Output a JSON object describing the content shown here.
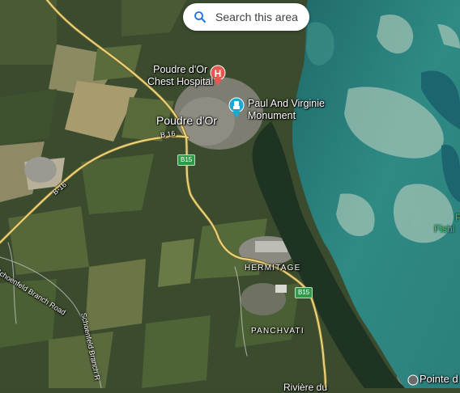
{
  "search": {
    "label": "Search this area",
    "icon": "search-icon"
  },
  "labels": {
    "chest_hospital": "Poudre d'Or\nChest Hospital",
    "monument": "Paul And Virginie\nMonument",
    "town": "Poudre d'Or",
    "hermitage": "HERMITAGE",
    "panchvati": "PANCHVATI",
    "pointe": "Pointe d",
    "riviere": "Rivière du",
    "fishing": "Fishi",
    "p_cut": "P"
  },
  "roads": {
    "b16_top": "B 16",
    "b16_left": "B-16",
    "schoenfeld_1": "Schoenfeld Branch Road",
    "schoenfeld_2": "Schoenfeld Branch R"
  },
  "shields": {
    "b15_top": "B15",
    "b15_bottom": "B15"
  },
  "colors": {
    "hospital_pin": "#e8574f",
    "monument_pin": "#1ba8d4",
    "road": "#e8d27a",
    "shield": "#2f9a4a",
    "poi_green": "#3cc46a"
  }
}
